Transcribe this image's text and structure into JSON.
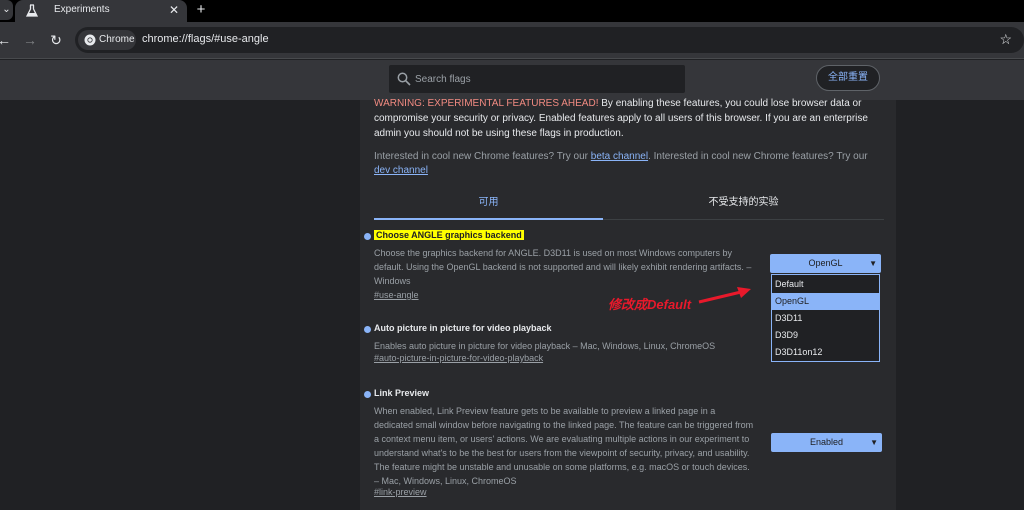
{
  "tabs": [
    {
      "title": "Experiments",
      "icon": "flask-icon"
    }
  ],
  "toolbar": {
    "chip_label": "Chrome",
    "url": "chrome://flags/#use-angle"
  },
  "header": {
    "search_placeholder": "Search flags",
    "reset_label": "全部重置"
  },
  "warning": {
    "strong": "WARNING: EXPERIMENTAL FEATURES AHEAD!",
    "text": " By enabling these features, you could lose browser data or compromise your security or privacy. Enabled features apply to all users of this browser. If you are an enterprise admin you should not be using these flags in production."
  },
  "interest": {
    "text1": "Interested in cool new Chrome features? Try our ",
    "link1": "beta channel",
    "text2": ". Interested in cool new Chrome features? Try our ",
    "link2": "dev channel"
  },
  "flag_tabs": {
    "available": "可用",
    "unavailable": "不受支持的实验"
  },
  "experiments": [
    {
      "name": "Choose ANGLE graphics backend",
      "desc": "Choose the graphics backend for ANGLE. D3D11 is used on most Windows computers by default. Using the OpenGL backend is not supported and will likely exhibit rendering artifacts. – Windows",
      "link": "#use-angle",
      "value": "OpenGL"
    },
    {
      "name": "Auto picture in picture for video playback",
      "desc": "Enables auto picture in picture for video playback – Mac, Windows, Linux, ChromeOS",
      "link": "#auto-picture-in-picture-for-video-playback"
    },
    {
      "name": "Link Preview",
      "desc": "When enabled, Link Preview feature gets to be available to preview a linked page in a dedicated small window before navigating to the linked page. The feature can be triggered from a context menu item, or users' actions. We are evaluating multiple actions in our experiment to understand what's to be the best for users from the viewpoint of security, privacy, and usability. The feature might be unstable and unusable on some platforms, e.g. macOS or touch devices. – Mac, Windows, Linux, ChromeOS",
      "link": "#link-preview",
      "value": "Enabled"
    }
  ],
  "dropdown_options": [
    "Default",
    "OpenGL",
    "D3D11",
    "D3D9",
    "D3D11on12"
  ],
  "dropdown_selected": "OpenGL",
  "annotation": "修改成Default",
  "colors": {
    "accent": "#8ab4f8",
    "highlight": "#ffff00",
    "warning": "#f28b82",
    "annotation": "#e8192b"
  }
}
